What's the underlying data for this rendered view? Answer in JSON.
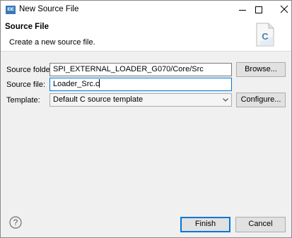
{
  "window": {
    "app_icon_text": "IDE",
    "title": "New Source File"
  },
  "banner": {
    "title": "Source File",
    "description": "Create a new source file.",
    "icon_letter": "C"
  },
  "form": {
    "source_folder": {
      "label": "Source folder:",
      "value": "SPI_EXTERNAL_LOADER_G070/Core/Src",
      "button": "Browse..."
    },
    "source_file": {
      "label": "Source file:",
      "value": "Loader_Src.c"
    },
    "template": {
      "label": "Template:",
      "selected": "Default C source template",
      "button": "Configure..."
    }
  },
  "footer": {
    "finish": "Finish",
    "cancel": "Cancel"
  },
  "icons": [
    "app-icon",
    "minimize-icon",
    "maximize-icon",
    "close-icon",
    "c-file-icon",
    "chevron-down-icon",
    "help-icon"
  ]
}
